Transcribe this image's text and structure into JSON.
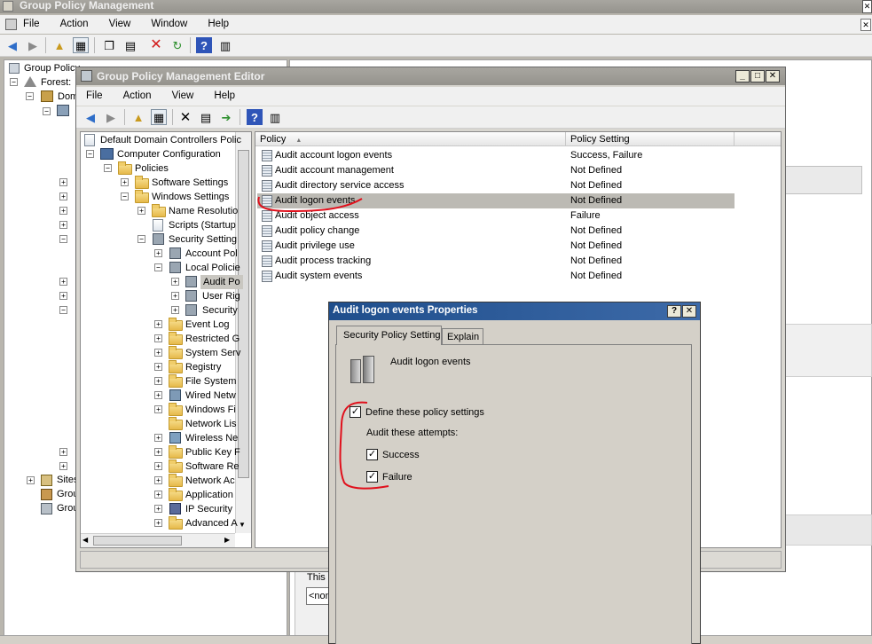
{
  "outer": {
    "title": "Group Policy Management",
    "menu": [
      "File",
      "Action",
      "View",
      "Window",
      "Help"
    ],
    "tree_root": "Group Policy",
    "tree_forest": "Forest:",
    "tree_dom": "Dom",
    "tree_sites": "Sites",
    "tree_grou1": "Grou",
    "tree_grou2": "Grou",
    "this_label": "This G",
    "none_value": "<non"
  },
  "editor": {
    "title": "Group Policy Management Editor",
    "menu": [
      "File",
      "Action",
      "View",
      "Help"
    ],
    "tree": {
      "root": "Default Domain Controllers Polic",
      "computer_config": "Computer Configuration",
      "policies": "Policies",
      "software_settings": "Software Settings",
      "windows_settings": "Windows Settings",
      "name_resolution": "Name Resolutio",
      "scripts": "Scripts (Startup",
      "security_settings": "Security Setting",
      "account_pol": "Account Pol",
      "local_policies": "Local Policie",
      "audit_po": "Audit Po",
      "user_rig": "User Rig",
      "security": "Security",
      "event_log": "Event Log",
      "restricted": "Restricted G",
      "system_serv": "System Serv",
      "registry": "Registry",
      "file_system": "File System",
      "wired_netw": "Wired Netw",
      "windows_fir": "Windows Fi",
      "network_lis": "Network Lis",
      "wireless_ne": "Wireless Ne",
      "public_key": "Public Key F",
      "software_re": "Software Re",
      "network_ac": "Network Ac",
      "application": "Application",
      "ip_security": "IP Security",
      "advanced": "Advanced A"
    },
    "columns": {
      "policy": "Policy",
      "setting": "Policy Setting"
    },
    "rows": [
      {
        "policy": "Audit account logon events",
        "setting": "Success, Failure"
      },
      {
        "policy": "Audit account management",
        "setting": "Not Defined"
      },
      {
        "policy": "Audit directory service access",
        "setting": "Not Defined"
      },
      {
        "policy": "Audit logon events",
        "setting": "Not Defined"
      },
      {
        "policy": "Audit object access",
        "setting": "Failure"
      },
      {
        "policy": "Audit policy change",
        "setting": "Not Defined"
      },
      {
        "policy": "Audit privilege use",
        "setting": "Not Defined"
      },
      {
        "policy": "Audit process tracking",
        "setting": "Not Defined"
      },
      {
        "policy": "Audit system events",
        "setting": "Not Defined"
      }
    ]
  },
  "dialog": {
    "title": "Audit logon events Properties",
    "help_btn": "?",
    "close_btn": "✕",
    "tabs": [
      "Security Policy Setting",
      "Explain"
    ],
    "policy_name": "Audit logon events",
    "define_label": "Define these policy settings",
    "attempts_label": "Audit these attempts:",
    "success_label": "Success",
    "failure_label": "Failure",
    "define_checked": true,
    "success_checked": true,
    "failure_checked": true
  },
  "colors": {
    "active_title": "#1f4e8c",
    "inactive_title": "#9c9a94",
    "selection": "#bcbab4",
    "annotation": "#e0101c"
  }
}
